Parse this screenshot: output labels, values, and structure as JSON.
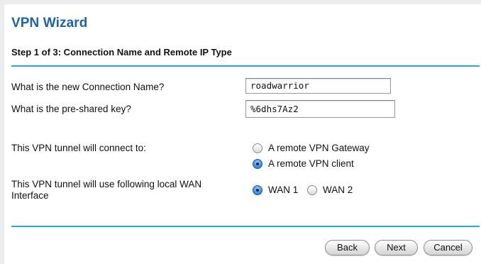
{
  "wizard": {
    "title": "VPN Wizard",
    "step": "Step 1 of 3: Connection Name and Remote IP Type"
  },
  "form": {
    "connection_name_label": "What is the new Connection Name?",
    "connection_name_value": "roadwarrior",
    "psk_label": "What is the pre-shared key?",
    "psk_value": "%6dhs7Az2",
    "tunnel_connect_label": "This VPN tunnel will connect to:",
    "tunnel_connect_options": [
      {
        "label": "A remote VPN Gateway",
        "selected": false
      },
      {
        "label": "A remote VPN client",
        "selected": true
      }
    ],
    "wan_label_line1": "This VPN tunnel will use following local WAN",
    "wan_label_line2": "Interface",
    "wan_options": [
      {
        "label": "WAN 1",
        "selected": true
      },
      {
        "label": "WAN 2",
        "selected": false
      }
    ]
  },
  "buttons": {
    "back": "Back",
    "next": "Next",
    "cancel": "Cancel"
  },
  "colors": {
    "title": "#1e63a8",
    "rule": "#2aa8d2",
    "radio_selected": "#3f8fe0"
  }
}
